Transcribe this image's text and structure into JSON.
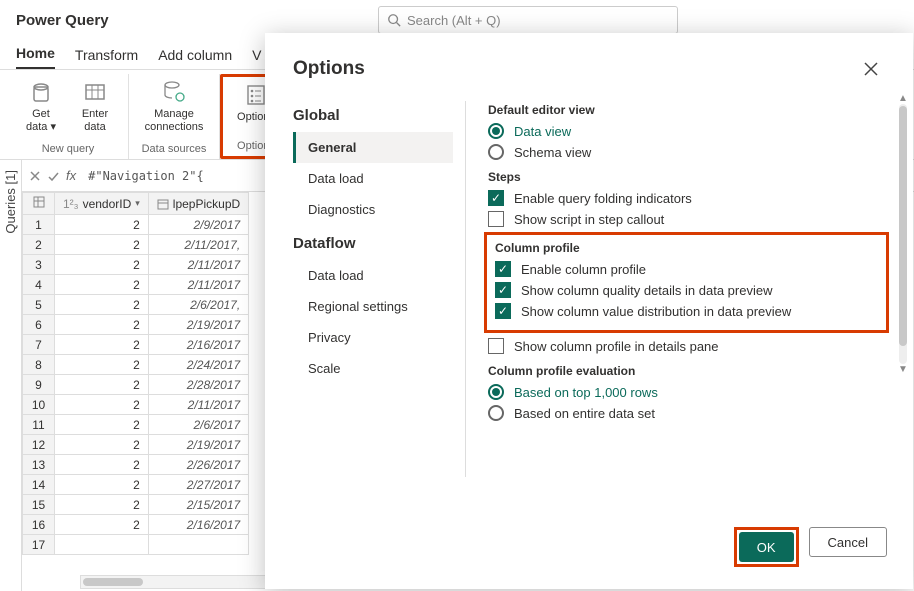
{
  "app": {
    "title": "Power Query"
  },
  "search": {
    "placeholder": "Search (Alt + Q)"
  },
  "tabs": [
    "Home",
    "Transform",
    "Add column",
    "V"
  ],
  "ribbon": {
    "groups": [
      {
        "label": "New query",
        "items": [
          {
            "label": "Get data ▾"
          },
          {
            "label": "Enter data"
          }
        ]
      },
      {
        "label": "Data sources",
        "items": [
          {
            "label": "Manage connections"
          }
        ]
      },
      {
        "label": "Options",
        "items": [
          {
            "label": "Options"
          }
        ]
      }
    ]
  },
  "queries_panel_label": "Queries [1]",
  "formula": {
    "text": "#\"Navigation 2\"{"
  },
  "columns": {
    "c1": "vendorID",
    "c2": "lpepPickupD"
  },
  "rows": [
    {
      "n": "1",
      "v": "2",
      "d": "2/9/2017"
    },
    {
      "n": "2",
      "v": "2",
      "d": "2/11/2017,"
    },
    {
      "n": "3",
      "v": "2",
      "d": "2/11/2017"
    },
    {
      "n": "4",
      "v": "2",
      "d": "2/11/2017"
    },
    {
      "n": "5",
      "v": "2",
      "d": "2/6/2017,"
    },
    {
      "n": "6",
      "v": "2",
      "d": "2/19/2017"
    },
    {
      "n": "7",
      "v": "2",
      "d": "2/16/2017"
    },
    {
      "n": "8",
      "v": "2",
      "d": "2/24/2017"
    },
    {
      "n": "9",
      "v": "2",
      "d": "2/28/2017"
    },
    {
      "n": "10",
      "v": "2",
      "d": "2/11/2017"
    },
    {
      "n": "11",
      "v": "2",
      "d": "2/6/2017"
    },
    {
      "n": "12",
      "v": "2",
      "d": "2/19/2017"
    },
    {
      "n": "13",
      "v": "2",
      "d": "2/26/2017"
    },
    {
      "n": "14",
      "v": "2",
      "d": "2/27/2017"
    },
    {
      "n": "15",
      "v": "2",
      "d": "2/15/2017"
    },
    {
      "n": "16",
      "v": "2",
      "d": "2/16/2017"
    },
    {
      "n": "17",
      "v": "",
      "d": ""
    }
  ],
  "dialog": {
    "title": "Options",
    "sections": {
      "global_label": "Global",
      "global": [
        "General",
        "Data load",
        "Diagnostics"
      ],
      "dataflow_label": "Dataflow",
      "dataflow": [
        "Data load",
        "Regional settings",
        "Privacy",
        "Scale"
      ]
    },
    "settings": {
      "editor_view_label": "Default editor view",
      "data_view": "Data view",
      "schema_view": "Schema view",
      "steps_label": "Steps",
      "enable_folding": "Enable query folding indicators",
      "show_script": "Show script in step callout",
      "column_profile_label": "Column profile",
      "enable_profile": "Enable column profile",
      "quality_preview": "Show column quality details in data preview",
      "value_dist": "Show column value distribution in data preview",
      "details_pane": "Show column profile in details pane",
      "eval_label": "Column profile evaluation",
      "top1000": "Based on top 1,000 rows",
      "entire": "Based on entire data set"
    },
    "ok": "OK",
    "cancel": "Cancel"
  }
}
